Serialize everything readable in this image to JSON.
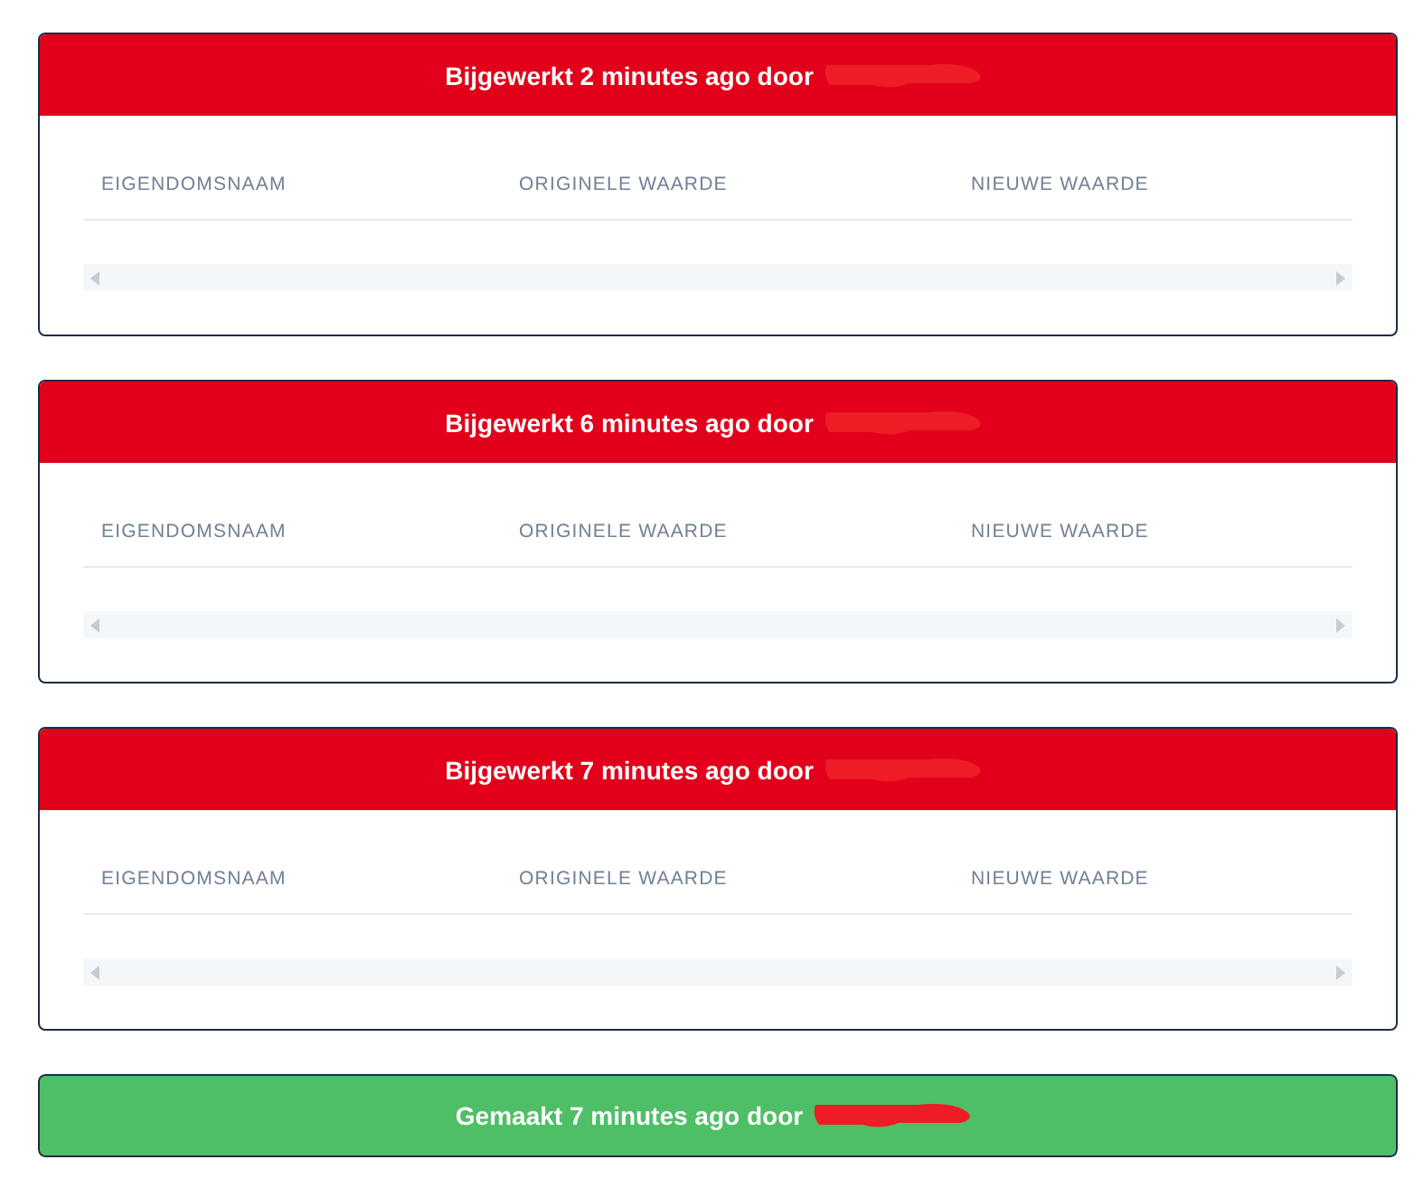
{
  "entries": [
    {
      "kind": "updated",
      "title": "Bijgewerkt 2 minutes ago door",
      "columns": [
        "EIGENDOMSNAAM",
        "ORIGINELE WAARDE",
        "NIEUWE WAARDE"
      ]
    },
    {
      "kind": "updated",
      "title": "Bijgewerkt 6 minutes ago door",
      "columns": [
        "EIGENDOMSNAAM",
        "ORIGINELE WAARDE",
        "NIEUWE WAARDE"
      ]
    },
    {
      "kind": "updated",
      "title": "Bijgewerkt 7 minutes ago door",
      "columns": [
        "EIGENDOMSNAAM",
        "ORIGINELE WAARDE",
        "NIEUWE WAARDE"
      ]
    },
    {
      "kind": "created",
      "title": "Gemaakt 7 minutes ago door"
    }
  ]
}
